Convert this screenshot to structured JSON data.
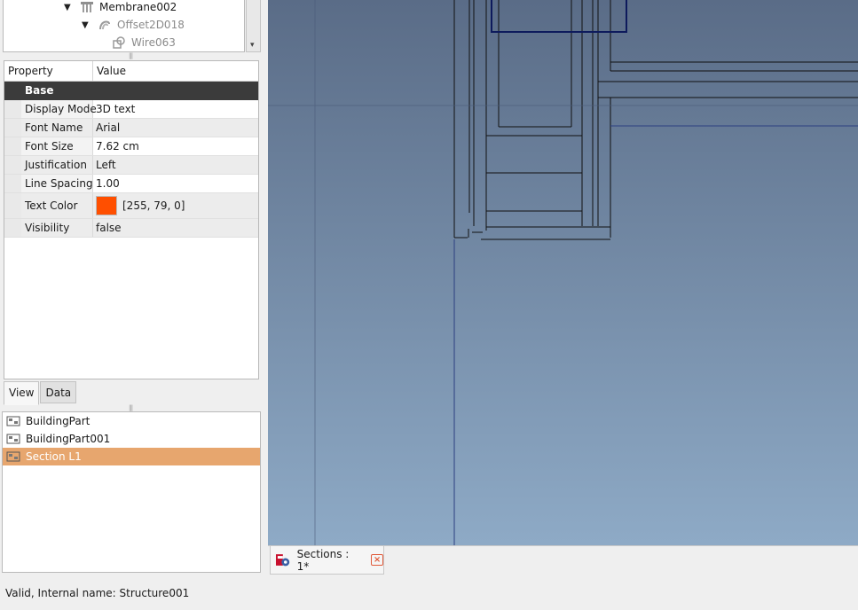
{
  "tree": {
    "items": [
      {
        "label": "Membrane002"
      },
      {
        "label": "Offset2D018"
      },
      {
        "label": "Wire063"
      }
    ]
  },
  "property_editor": {
    "col_property": "Property",
    "col_value": "Value",
    "group": "Base",
    "rows": [
      {
        "name": "Display Mode",
        "value": "3D text"
      },
      {
        "name": "Font Name",
        "value": "Arial"
      },
      {
        "name": "Font Size",
        "value": "7.62 cm"
      },
      {
        "name": "Justification",
        "value": "Left"
      },
      {
        "name": "Line Spacing",
        "value": "1.00"
      },
      {
        "name": "Text Color",
        "value": "[255, 79, 0]",
        "color": "#ff4f00"
      },
      {
        "name": "Visibility",
        "value": "false"
      }
    ]
  },
  "tabs": {
    "view": "View",
    "data": "Data"
  },
  "selection": {
    "items": [
      {
        "label": "BuildingPart"
      },
      {
        "label": "BuildingPart001"
      },
      {
        "label": "Section L1"
      }
    ]
  },
  "document_tab": {
    "label": "Sections : 1*"
  },
  "status_bar": {
    "text": "Valid, Internal name: Structure001"
  },
  "colors": {
    "selection": "#e7a66e",
    "group_header": "#3b3b3b",
    "viewport_top": "#5a6c87",
    "viewport_bottom": "#8eaac6"
  }
}
